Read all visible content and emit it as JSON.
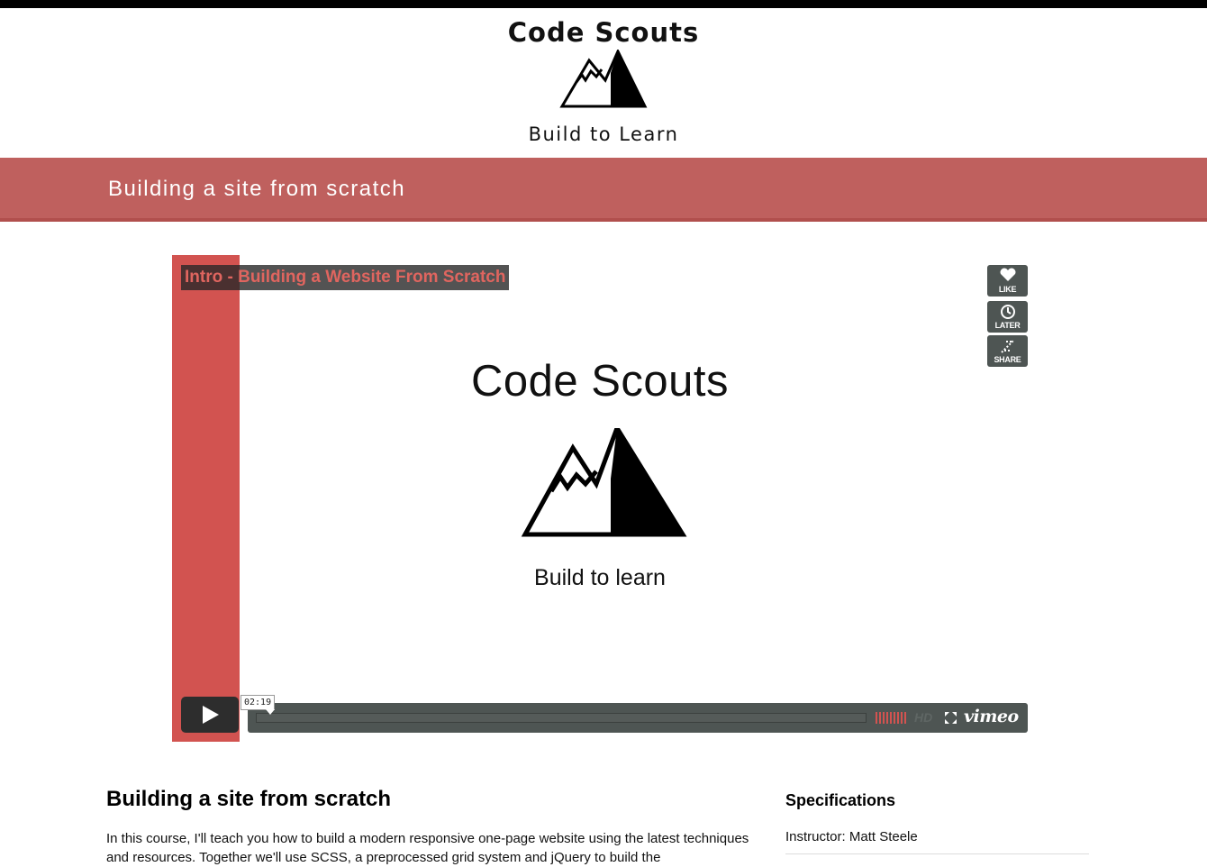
{
  "header": {
    "title": "Code Scouts",
    "tagline": "Build to Learn"
  },
  "banner": {
    "title": "Building a site from scratch"
  },
  "player": {
    "title_prefix": "Intro - ",
    "title_link": "Building a Website From Scratch",
    "slide_title": "Code Scouts",
    "slide_tagline": "Build to learn",
    "like_label": "LIKE",
    "later_label": "LATER",
    "share_label": "SHARE",
    "timecode": "02:19",
    "hd_label": "HD",
    "brand": "vimeo",
    "progress": 0,
    "accent_color": "#d25350"
  },
  "content": {
    "title": "Building a site from scratch",
    "body": "In this course, I'll teach you how to build a modern responsive one-page website using the latest techniques and resources. Together we'll use SCSS, a preprocessed grid system and jQuery to build the"
  },
  "specifications": {
    "title": "Specifications",
    "instructor": "Instructor: Matt Steele"
  },
  "colors": {
    "banner": "#bf605e",
    "strip": "#d25350"
  }
}
